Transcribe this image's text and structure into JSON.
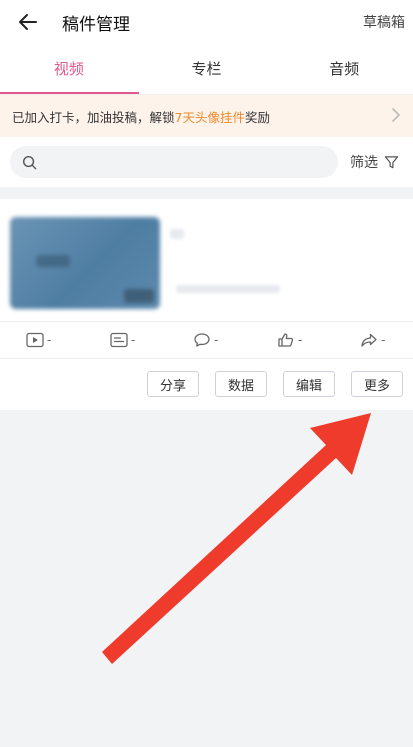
{
  "header": {
    "title": "稿件管理",
    "drafts_label": "草稿箱"
  },
  "tabs": [
    {
      "label": "视频",
      "active": true
    },
    {
      "label": "专栏",
      "active": false
    },
    {
      "label": "音频",
      "active": false
    }
  ],
  "banner": {
    "text_before": "已加入打卡，加油投稿，解锁",
    "highlight": "7天头像挂件",
    "text_after": "奖励"
  },
  "search": {
    "placeholder": ""
  },
  "filter_label": "筛选",
  "video": {
    "stats": [
      {
        "icon": "play-icon",
        "value": "-"
      },
      {
        "icon": "danmaku-icon",
        "value": "-"
      },
      {
        "icon": "comment-icon",
        "value": "-"
      },
      {
        "icon": "like-icon",
        "value": "-"
      },
      {
        "icon": "share-icon",
        "value": "-"
      }
    ],
    "actions": {
      "share": "分享",
      "data": "数据",
      "edit": "编辑",
      "more": "更多"
    }
  },
  "colors": {
    "accent": "#e2588c",
    "highlight": "#f08a2b",
    "arrow": "#ef3b2c"
  }
}
